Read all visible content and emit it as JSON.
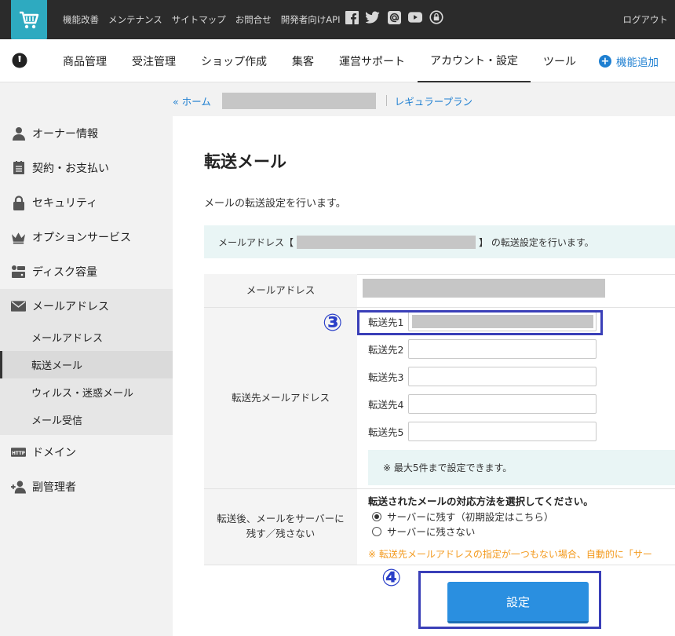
{
  "topbar": {
    "links": [
      "機能改善",
      "メンテナンス",
      "サイトマップ",
      "お問合せ",
      "開発者向けAPI"
    ],
    "social_icons": [
      "facebook-icon",
      "twitter-icon",
      "at-icon",
      "youtube-icon",
      "lock-icon"
    ],
    "logout": "ログアウト"
  },
  "nav": {
    "items": [
      "商品管理",
      "受注管理",
      "ショップ作成",
      "集客",
      "運営サポート",
      "アカウント・設定",
      "ツール"
    ],
    "active": "アカウント・設定",
    "add": "機能追加"
  },
  "breadcrumb": {
    "home": "« ホーム",
    "plan": "レギュラープラン"
  },
  "sidebar": {
    "items": [
      {
        "label": "オーナー情報",
        "icon": "user-icon"
      },
      {
        "label": "契約・お支払い",
        "icon": "document-icon"
      },
      {
        "label": "セキュリティ",
        "icon": "lock-icon"
      },
      {
        "label": "オプションサービス",
        "icon": "crown-icon"
      },
      {
        "label": "ディスク容量",
        "icon": "disk-icon"
      },
      {
        "label": "メールアドレス",
        "icon": "mail-icon"
      },
      {
        "label": "ドメイン",
        "icon": "http-icon"
      },
      {
        "label": "副管理者",
        "icon": "add-user-icon"
      }
    ],
    "sub_items": [
      "メールアドレス",
      "転送メール",
      "ウィルス・迷惑メール",
      "メール受信"
    ],
    "current_sub": "転送メール"
  },
  "page": {
    "title": "転送メール",
    "description": "メールの転送設定を行います。",
    "notice_prefix": "メールアドレス【",
    "notice_suffix": "】 の転送設定を行います。"
  },
  "form": {
    "email_label": "メールアドレス",
    "forward_label": "転送先メールアドレス",
    "forward_fields": [
      "転送先1",
      "転送先2",
      "転送先3",
      "転送先4",
      "転送先5"
    ],
    "max_note": "※ 最大5件まで設定できます。",
    "retain_label": "転送後、メールをサーバーに残す／残さない",
    "retain_title": "転送されたメールの対応方法を選択してください。",
    "retain_options": [
      "サーバーに残す（初期設定はこちら）",
      "サーバーに残さない"
    ],
    "retain_selected": 0,
    "warning": "※ 転送先メールアドレスの指定が一つもない場合、自動的に「サー",
    "submit": "設定"
  },
  "annotations": {
    "step3": "③",
    "step4": "④",
    "color": "#3a3fb8"
  },
  "colors": {
    "accent": "#2eaac0",
    "link": "#1e7fd1",
    "button": "#2a8fe0",
    "warning": "#f39a1e"
  }
}
